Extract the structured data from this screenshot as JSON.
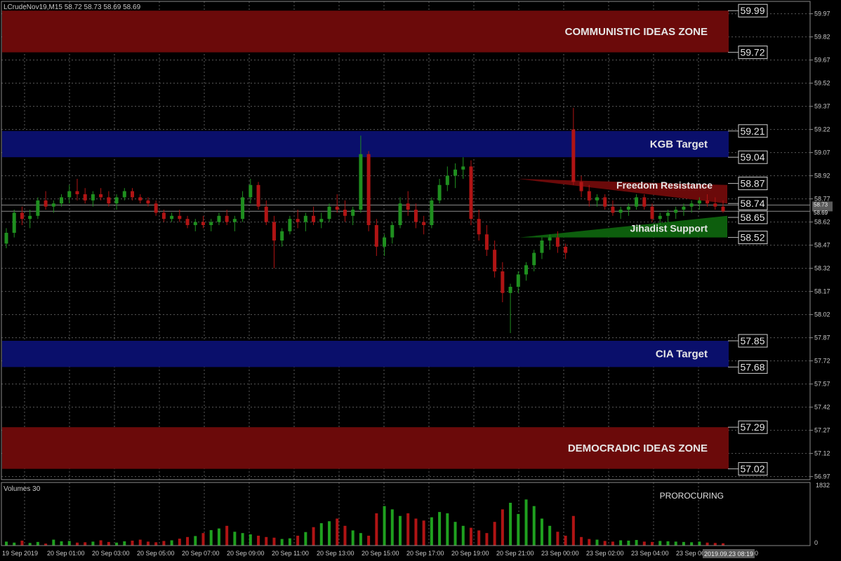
{
  "header": {
    "symbol_line": "LCrudeNov19,M15  58.72 58.73 58.69 58.69"
  },
  "colors": {
    "background": "#000000",
    "grid": "#5a5a5a",
    "axis_text": "#c8c8c8",
    "red_zone": "#6b0a0a",
    "blue_zone": "#0a0f6b",
    "bull_candle": "#1f8f1f",
    "bear_candle": "#b01414",
    "zone_text": "#e6e6e6",
    "price_line": "#c8c8c8"
  },
  "zones": [
    {
      "name": "communistic-ideas-zone",
      "label": "COMMUNISTIC IDEAS ZONE",
      "top": 59.99,
      "bottom": 59.72,
      "color": "#6b0a0a",
      "marker_top": "59.99",
      "marker_bottom": "59.72"
    },
    {
      "name": "kgb-target",
      "label": "KGB Target",
      "top": 59.21,
      "bottom": 59.04,
      "color": "#0a0f6b",
      "marker_top": "59.21",
      "marker_bottom": "59.04"
    },
    {
      "name": "cia-target",
      "label": "CIA Target",
      "top": 57.85,
      "bottom": 57.68,
      "color": "#0a0f6b",
      "marker_top": "57.85",
      "marker_bottom": "57.68"
    },
    {
      "name": "democradic-ideas-zone",
      "label": "DEMOCRADIC IDEAS ZONE",
      "top": 57.29,
      "bottom": 57.02,
      "color": "#6b0a0a",
      "marker_top": "57.29",
      "marker_bottom": "57.02"
    }
  ],
  "wedges": [
    {
      "name": "freedom-resistance",
      "label": "Freedom Resistance",
      "marker_top": "58.87",
      "marker_bottom": "58.74",
      "color": "#6b0a0a"
    },
    {
      "name": "jihadist-support",
      "label": "Jihadist Support",
      "marker_top": "58.65",
      "marker_bottom": "58.52",
      "color": "#0d5e0d"
    }
  ],
  "price_axis": {
    "ticks": [
      "59.97",
      "59.82",
      "59.67",
      "59.52",
      "59.37",
      "59.22",
      "59.07",
      "58.92",
      "58.77",
      "58.62",
      "58.47",
      "58.32",
      "58.17",
      "58.02",
      "57.87",
      "57.72",
      "57.57",
      "57.42",
      "57.27",
      "57.12",
      "56.97"
    ],
    "current_price_a": "58.73",
    "current_price_b": "58.69"
  },
  "time_axis": {
    "labels": [
      "19 Sep 2019",
      "20 Sep 01:00",
      "20 Sep 03:00",
      "20 Sep 05:00",
      "20 Sep 07:00",
      "20 Sep 09:00",
      "20 Sep 11:00",
      "20 Sep 13:00",
      "20 Sep 15:00",
      "20 Sep 17:00",
      "20 Sep 19:00",
      "20 Sep 21:00",
      "23 Sep 00:00",
      "23 Sep 02:00",
      "23 Sep 04:00",
      "23 Sep 06:00"
    ],
    "crosshair_time": "2019.09.23 08:19",
    "trailing_digit": "0"
  },
  "volume_panel": {
    "title": "Volumes 30",
    "max_label": "1832",
    "zero_label": "0",
    "watermark": "PROROCURING"
  },
  "chart_data": {
    "type": "candlestick",
    "symbol": "LCrudeNov19",
    "timeframe": "M15",
    "ylim": [
      56.95,
      60.05
    ],
    "candles": [
      [
        58.48,
        58.58,
        58.45,
        58.55
      ],
      [
        58.55,
        58.7,
        58.52,
        58.68
      ],
      [
        58.68,
        58.72,
        58.6,
        58.64
      ],
      [
        58.64,
        58.7,
        58.58,
        58.66
      ],
      [
        58.66,
        58.78,
        58.64,
        58.76
      ],
      [
        58.76,
        58.82,
        58.7,
        58.72
      ],
      [
        58.72,
        58.76,
        58.68,
        58.74
      ],
      [
        58.74,
        58.8,
        58.72,
        58.78
      ],
      [
        58.78,
        58.86,
        58.74,
        58.82
      ],
      [
        58.82,
        58.9,
        58.76,
        58.8
      ],
      [
        58.8,
        58.84,
        58.74,
        58.76
      ],
      [
        58.76,
        58.82,
        58.72,
        58.8
      ],
      [
        58.8,
        58.84,
        58.76,
        58.78
      ],
      [
        58.78,
        58.82,
        58.72,
        58.74
      ],
      [
        58.74,
        58.8,
        58.7,
        58.78
      ],
      [
        58.78,
        58.84,
        58.76,
        58.82
      ],
      [
        58.82,
        58.84,
        58.76,
        58.78
      ],
      [
        58.78,
        58.8,
        58.74,
        58.76
      ],
      [
        58.76,
        58.78,
        58.72,
        58.74
      ],
      [
        58.74,
        58.76,
        58.66,
        58.68
      ],
      [
        58.68,
        58.7,
        58.62,
        58.64
      ],
      [
        58.64,
        58.68,
        58.62,
        58.66
      ],
      [
        58.66,
        58.7,
        58.62,
        58.64
      ],
      [
        58.64,
        58.66,
        58.58,
        58.6
      ],
      [
        58.6,
        58.64,
        58.56,
        58.62
      ],
      [
        58.62,
        58.66,
        58.58,
        58.6
      ],
      [
        58.6,
        58.64,
        58.56,
        58.62
      ],
      [
        58.62,
        58.68,
        58.6,
        58.66
      ],
      [
        58.66,
        58.7,
        58.6,
        58.62
      ],
      [
        58.62,
        58.66,
        58.56,
        58.64
      ],
      [
        58.64,
        58.82,
        58.62,
        58.78
      ],
      [
        58.78,
        58.9,
        58.74,
        58.86
      ],
      [
        58.86,
        58.88,
        58.7,
        58.72
      ],
      [
        58.72,
        58.76,
        58.6,
        58.62
      ],
      [
        58.62,
        58.66,
        58.32,
        58.5
      ],
      [
        58.5,
        58.58,
        58.46,
        58.56
      ],
      [
        58.56,
        58.66,
        58.54,
        58.64
      ],
      [
        58.64,
        58.7,
        58.58,
        58.62
      ],
      [
        58.62,
        58.68,
        58.56,
        58.66
      ],
      [
        58.66,
        58.72,
        58.6,
        58.62
      ],
      [
        58.62,
        58.68,
        58.58,
        58.64
      ],
      [
        58.64,
        58.74,
        58.62,
        58.72
      ],
      [
        58.72,
        58.8,
        58.68,
        58.7
      ],
      [
        58.7,
        58.76,
        58.62,
        58.66
      ],
      [
        58.66,
        58.72,
        58.6,
        58.7
      ],
      [
        58.7,
        59.18,
        58.68,
        59.06
      ],
      [
        59.06,
        59.08,
        58.56,
        58.6
      ],
      [
        58.6,
        58.64,
        58.4,
        58.46
      ],
      [
        58.46,
        58.54,
        58.4,
        58.52
      ],
      [
        58.52,
        58.62,
        58.48,
        58.6
      ],
      [
        58.6,
        58.78,
        58.58,
        58.74
      ],
      [
        58.74,
        58.82,
        58.66,
        58.7
      ],
      [
        58.7,
        58.74,
        58.58,
        58.62
      ],
      [
        58.62,
        58.66,
        58.54,
        58.6
      ],
      [
        58.6,
        58.78,
        58.58,
        58.76
      ],
      [
        58.76,
        58.9,
        58.74,
        58.86
      ],
      [
        58.86,
        58.98,
        58.82,
        58.92
      ],
      [
        58.92,
        59.0,
        58.84,
        58.96
      ],
      [
        58.96,
        59.04,
        58.9,
        58.98
      ],
      [
        58.98,
        59.02,
        58.6,
        58.64
      ],
      [
        58.64,
        58.7,
        58.5,
        58.54
      ],
      [
        58.54,
        58.6,
        58.4,
        58.44
      ],
      [
        58.44,
        58.5,
        58.26,
        58.3
      ],
      [
        58.3,
        58.36,
        58.1,
        58.16
      ],
      [
        58.16,
        58.22,
        57.9,
        58.2
      ],
      [
        58.2,
        58.3,
        58.16,
        58.28
      ],
      [
        58.28,
        58.36,
        58.24,
        58.34
      ],
      [
        58.34,
        58.44,
        58.3,
        58.42
      ],
      [
        58.42,
        58.52,
        58.38,
        58.5
      ],
      [
        58.5,
        58.54,
        58.44,
        58.52
      ],
      [
        58.52,
        58.56,
        58.42,
        58.46
      ],
      [
        58.46,
        58.48,
        58.38,
        58.42
      ],
      [
        59.22,
        59.36,
        58.86,
        58.88
      ],
      [
        58.88,
        58.92,
        58.78,
        58.82
      ],
      [
        58.82,
        58.86,
        58.72,
        58.76
      ],
      [
        58.76,
        58.8,
        58.72,
        58.78
      ],
      [
        58.78,
        58.8,
        58.7,
        58.72
      ],
      [
        58.72,
        58.76,
        58.66,
        58.68
      ],
      [
        58.68,
        58.72,
        58.64,
        58.7
      ],
      [
        58.7,
        58.74,
        58.66,
        58.72
      ],
      [
        58.72,
        58.8,
        58.7,
        58.78
      ],
      [
        58.78,
        58.8,
        58.7,
        58.72
      ],
      [
        58.72,
        58.74,
        58.62,
        58.64
      ],
      [
        58.64,
        58.68,
        58.6,
        58.66
      ],
      [
        58.66,
        58.7,
        58.62,
        58.68
      ],
      [
        58.68,
        58.72,
        58.64,
        58.7
      ],
      [
        58.7,
        58.74,
        58.66,
        58.72
      ],
      [
        58.72,
        58.76,
        58.68,
        58.74
      ],
      [
        58.74,
        58.78,
        58.7,
        58.76
      ],
      [
        58.76,
        58.8,
        58.72,
        58.74
      ],
      [
        58.74,
        58.78,
        58.7,
        58.72
      ],
      [
        58.72,
        58.76,
        58.68,
        58.69
      ]
    ],
    "volumes": [
      120,
      90,
      150,
      80,
      110,
      60,
      180,
      130,
      140,
      90,
      100,
      120,
      160,
      110,
      90,
      130,
      150,
      180,
      120,
      100,
      140,
      160,
      210,
      260,
      290,
      380,
      470,
      520,
      600,
      420,
      380,
      340,
      300,
      260,
      240,
      200,
      220,
      300,
      410,
      560,
      680,
      740,
      820,
      600,
      460,
      380,
      300,
      980,
      1200,
      1100,
      900,
      980,
      820,
      760,
      860,
      1020,
      980,
      720,
      600,
      540,
      460,
      380,
      720,
      1100,
      1300,
      960,
      1400,
      1200,
      820,
      600,
      420,
      300,
      900,
      260,
      200,
      180,
      140,
      120,
      160,
      150,
      170,
      120,
      110,
      140,
      130,
      120,
      110,
      100,
      120,
      90,
      80,
      70
    ]
  }
}
